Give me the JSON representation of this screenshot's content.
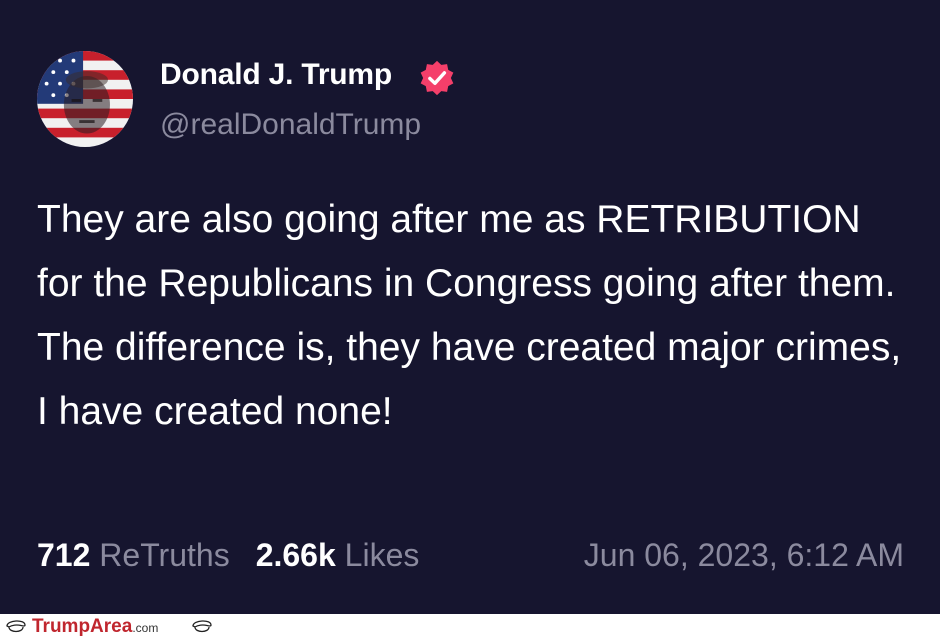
{
  "post": {
    "display_name": "Donald J. Trump",
    "handle": "@realDonaldTrump",
    "body": "They are also going after me as RETRIBUTION for the Republicans in Congress going after them. The difference is, they have created major crimes, I have created none!",
    "retruths_count": "712",
    "retruths_label": "ReTruths",
    "likes_count": "2.66k",
    "likes_label": "Likes",
    "timestamp": "Jun 06, 2023, 6:12 AM",
    "verified_icon": "verified-badge-icon",
    "avatar_icon": "flag-portrait-avatar"
  },
  "footer": {
    "brand": "TrumpArea",
    "domain": ".com",
    "icon": "trump-hair-icon"
  },
  "colors": {
    "background": "#16152f",
    "text": "#ffffff",
    "muted": "#8b8a9e",
    "verified": "#f43f6a",
    "brand": "#c0262e"
  }
}
